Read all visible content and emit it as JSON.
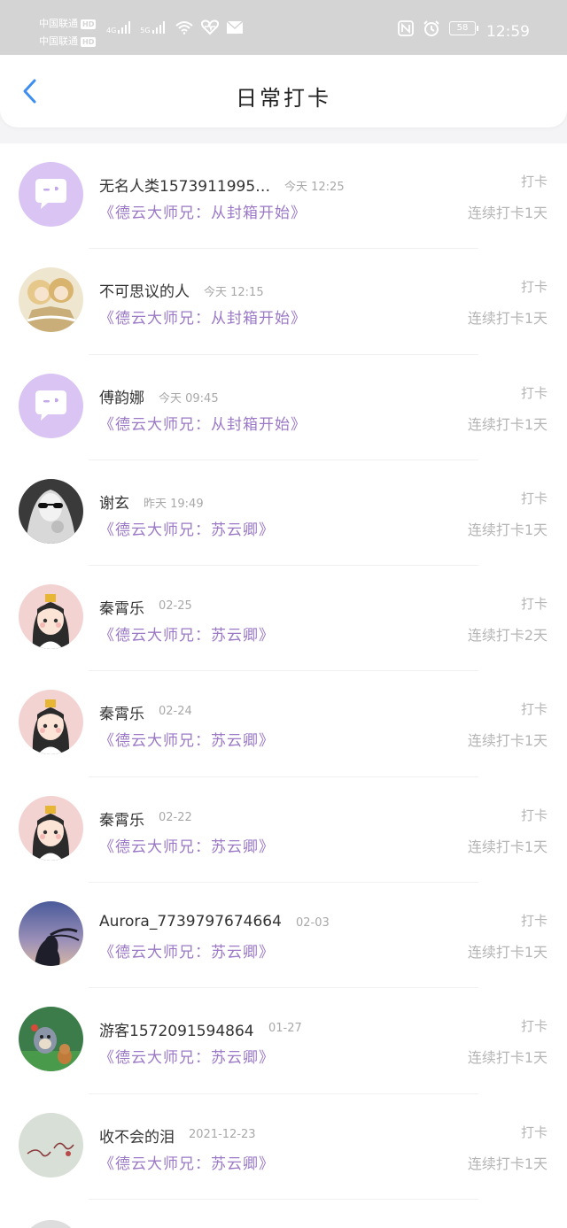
{
  "status_bar": {
    "carrier1": "中国联通",
    "carrier2": "中国联通",
    "hd": "HD",
    "net1": "4G",
    "net2": "5G",
    "battery": "58",
    "time": "12:59"
  },
  "header": {
    "title": "日常打卡"
  },
  "items": [
    {
      "name": "无名人类1573911995…",
      "time": "今天 12:25",
      "book": "《德云大师兄：从封箱开始》",
      "checkin": "打卡",
      "streak": "连续打卡1天",
      "avatar": "chat-bubble-icon"
    },
    {
      "name": "不可思议的人",
      "time": "今天 12:15",
      "book": "《德云大师兄：从封箱开始》",
      "checkin": "打卡",
      "streak": "连续打卡1天",
      "avatar": "anime-photo"
    },
    {
      "name": "傅韵娜",
      "time": "今天 09:45",
      "book": "《德云大师兄：从封箱开始》",
      "checkin": "打卡",
      "streak": "连续打卡1天",
      "avatar": "chat-bubble-icon"
    },
    {
      "name": "谢玄",
      "time": "昨天 19:49",
      "book": "《德云大师兄：苏云卿》",
      "checkin": "打卡",
      "streak": "连续打卡1天",
      "avatar": "sunglasses-photo"
    },
    {
      "name": "秦霄乐",
      "time": "02-25",
      "book": "《德云大师兄：苏云卿》",
      "checkin": "打卡",
      "streak": "连续打卡2天",
      "avatar": "anime-girl"
    },
    {
      "name": "秦霄乐",
      "time": "02-24",
      "book": "《德云大师兄：苏云卿》",
      "checkin": "打卡",
      "streak": "连续打卡1天",
      "avatar": "anime-girl"
    },
    {
      "name": "秦霄乐",
      "time": "02-22",
      "book": "《德云大师兄：苏云卿》",
      "checkin": "打卡",
      "streak": "连续打卡1天",
      "avatar": "anime-girl"
    },
    {
      "name": "Aurora_7739797674664",
      "time": "02-03",
      "book": "《德云大师兄：苏云卿》",
      "checkin": "打卡",
      "streak": "连续打卡1天",
      "avatar": "sunset-photo"
    },
    {
      "name": "游客1572091594864",
      "time": "01-27",
      "book": "《德云大师兄：苏云卿》",
      "checkin": "打卡",
      "streak": "连续打卡1天",
      "avatar": "cartoon-photo"
    },
    {
      "name": "收不会的泪",
      "time": "2021-12-23",
      "book": "《德云大师兄：苏云卿》",
      "checkin": "打卡",
      "streak": "连续打卡1天",
      "avatar": "handwriting-photo"
    }
  ]
}
